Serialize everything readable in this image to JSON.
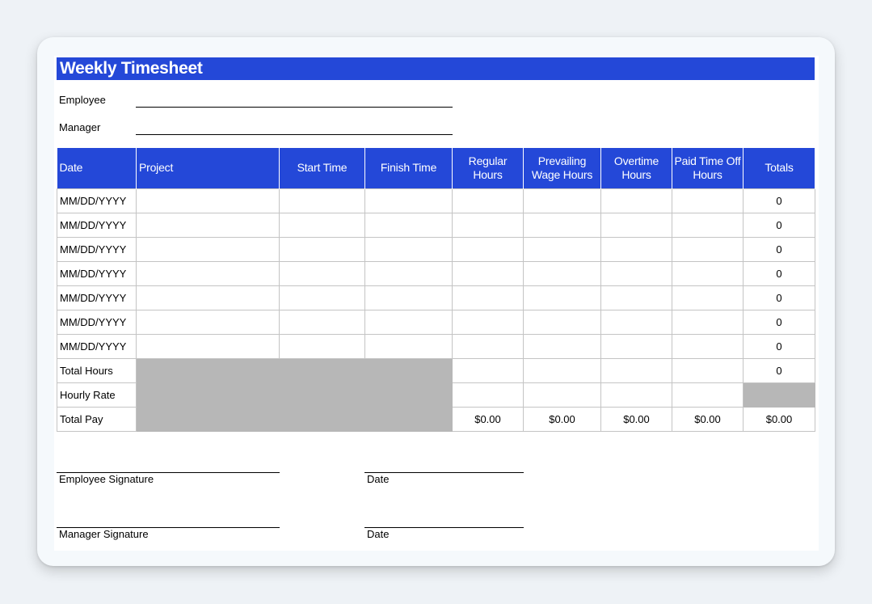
{
  "title": "Weekly Timesheet",
  "fields": {
    "employee_label": "Employee",
    "manager_label": "Manager"
  },
  "table": {
    "headers": [
      "Date",
      "Project",
      "Start Time",
      "Finish Time",
      "Regular Hours",
      "Prevailing Wage Hours",
      "Overtime Hours",
      "Paid Time Off Hours",
      "Totals"
    ],
    "date_rows": [
      {
        "date": "MM/DD/YYYY",
        "total": "0"
      },
      {
        "date": "MM/DD/YYYY",
        "total": "0"
      },
      {
        "date": "MM/DD/YYYY",
        "total": "0"
      },
      {
        "date": "MM/DD/YYYY",
        "total": "0"
      },
      {
        "date": "MM/DD/YYYY",
        "total": "0"
      },
      {
        "date": "MM/DD/YYYY",
        "total": "0"
      },
      {
        "date": "MM/DD/YYYY",
        "total": "0"
      }
    ],
    "total_hours": {
      "label": "Total Hours",
      "total": "0"
    },
    "hourly_rate": {
      "label": "Hourly Rate"
    },
    "total_pay": {
      "label": "Total Pay",
      "regular": "$0.00",
      "prevailing": "$0.00",
      "overtime": "$0.00",
      "pto": "$0.00",
      "total": "$0.00"
    }
  },
  "signatures": {
    "employee_signature": "Employee Signature",
    "employee_date": "Date",
    "manager_signature": "Manager Signature",
    "manager_date": "Date"
  },
  "colors": {
    "header_blue": "#2448d8",
    "gray_fill": "#b7b7b7"
  }
}
